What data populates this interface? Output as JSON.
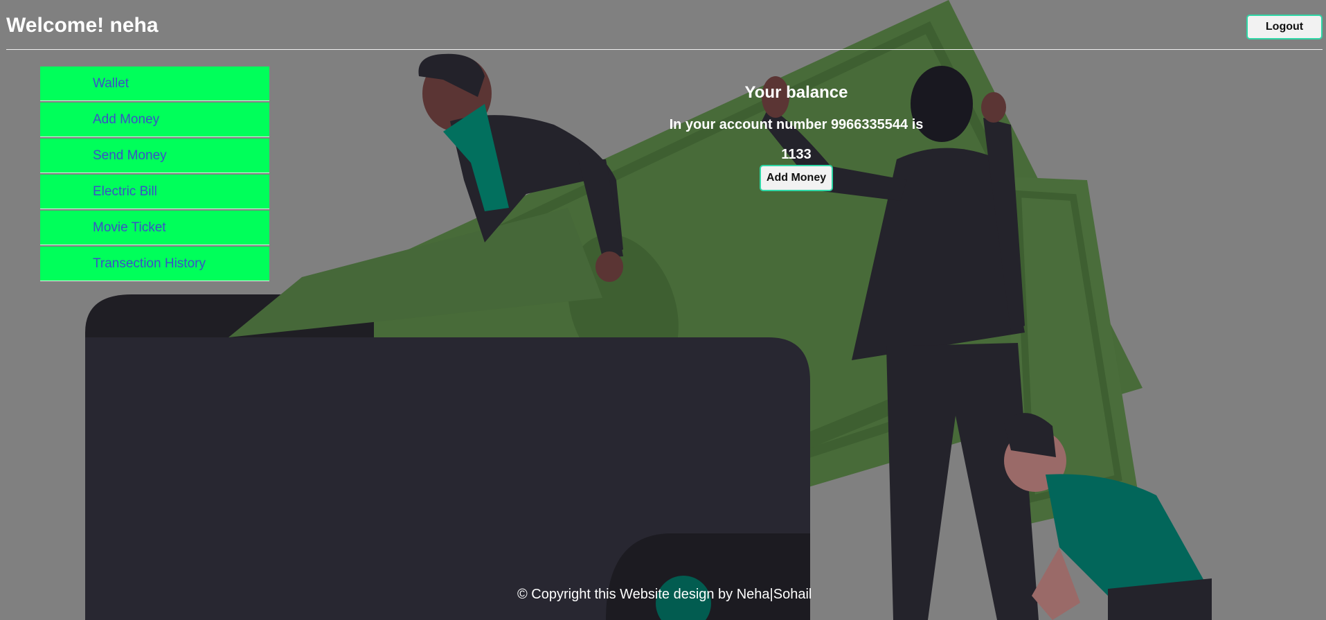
{
  "header": {
    "welcome_text": "Welcome! neha",
    "logout_label": "Logout"
  },
  "sidebar": {
    "items": [
      {
        "label": "Wallet"
      },
      {
        "label": "Add Money"
      },
      {
        "label": "Send Money"
      },
      {
        "label": "Electric Bill"
      },
      {
        "label": "Movie Ticket"
      },
      {
        "label": "Transection History"
      }
    ]
  },
  "balance": {
    "title": "Your balance",
    "account_text": "In your account number 9966335544 is",
    "amount": "1133",
    "add_money_label": "Add Money"
  },
  "footer": {
    "copyright": "© Copyright this Website design by Neha|Sohail"
  },
  "colors": {
    "page_background": "#808080",
    "sidebar_item": "#00ff5a",
    "sidebar_text": "#3c4fc7",
    "button_border": "#2fd7a6",
    "banknote": "#486b39",
    "wallet": "#282731"
  },
  "illustration": {
    "subject": "money-wallet-illustration"
  }
}
